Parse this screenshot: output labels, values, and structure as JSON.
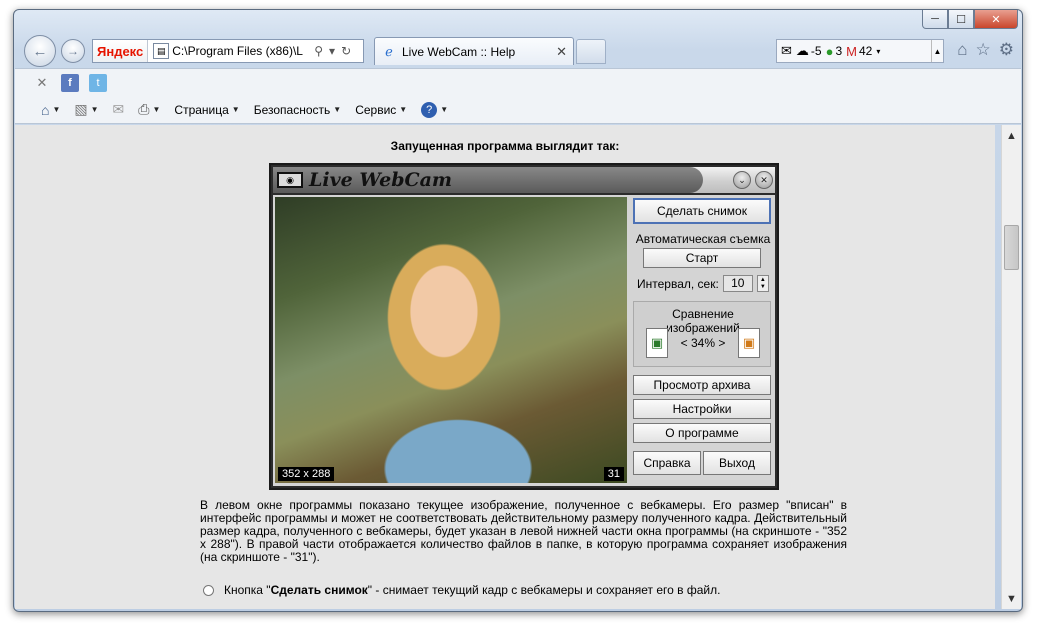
{
  "window": {
    "min_glyph": "─",
    "max_glyph": "☐",
    "close_glyph": "✕"
  },
  "nav": {
    "back_glyph": "←",
    "forward_glyph": "→"
  },
  "address": {
    "brand": "Яндекс",
    "url": "C:\\Program Files (x86)\\L",
    "search_glyph": "⚲",
    "dropdown_glyph": "▾",
    "refresh_glyph": "↻"
  },
  "tab": {
    "title": "Live WebCam :: Help",
    "close_glyph": "✕"
  },
  "extensions": {
    "weather_value": "-5",
    "green_count": "3",
    "mail_count": "42"
  },
  "commandbar": {
    "page": "Страница",
    "security": "Безопасность",
    "service": "Сервис"
  },
  "content": {
    "heading": "Запущенная программа выглядит так:",
    "paragraph": "В левом окне программы показано текущее изображение, полученное с вебкамеры. Его размер \"вписан\" в интерфейс программы и может не соответствовать действительному размеру полученного кадра. Действительный размер кадра, полученного с вебкамеры, будет указан в левой нижней части окна программы (на скриншоте - \"352 x 288\"). В правой части отображается количество файлов в папке, в которую программа сохраняет изображения (на скриншоте - \"31\").",
    "bullet_bold": "Сделать снимок",
    "bullet_prefix": "Кнопка \"",
    "bullet_suffix": "\" - снимает текущий кадр с вебкамеры и сохраняет его в файл."
  },
  "app": {
    "name": "Live WebCam",
    "frame_size": "352 x 288",
    "file_count": "31",
    "snapshot_btn": "Сделать снимок",
    "auto_label": "Автоматическая съемка",
    "start_btn": "Старт",
    "interval_label": "Интервал, сек:",
    "interval_value": "10",
    "compare_label": "Сравнение изображений",
    "compare_value": "< 34% >",
    "archive_btn": "Просмотр архива",
    "settings_btn": "Настройки",
    "about_btn": "О программе",
    "help_btn": "Справка",
    "exit_btn": "Выход"
  }
}
